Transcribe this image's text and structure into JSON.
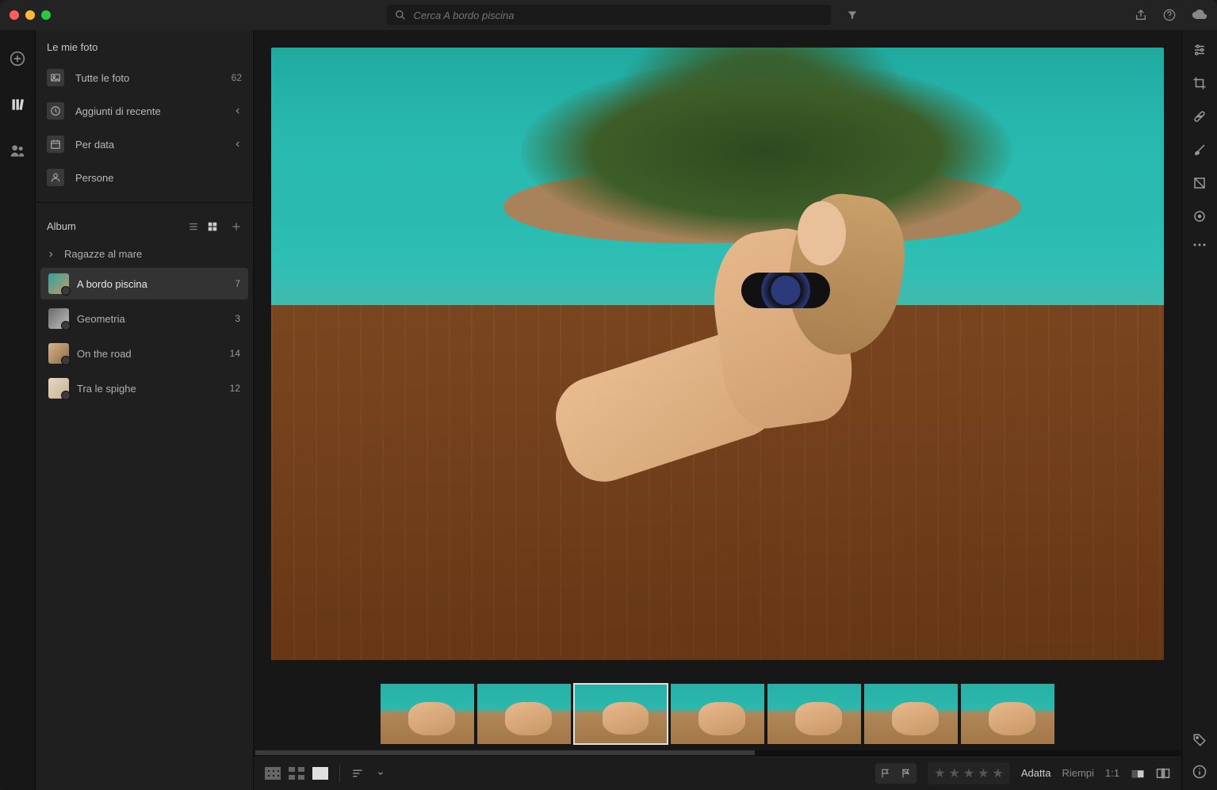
{
  "titlebar": {
    "search_placeholder": "Cerca A bordo piscina"
  },
  "sidebar": {
    "my_photos_header": "Le mie foto",
    "rows": [
      {
        "label": "Tutte le foto",
        "count": "62"
      },
      {
        "label": "Aggiunti di recente"
      },
      {
        "label": "Per data"
      },
      {
        "label": "Persone"
      }
    ],
    "album_header": "Album",
    "group_label": "Ragazze al mare",
    "albums": [
      {
        "label": "A bordo piscina",
        "count": "7",
        "selected": true,
        "thumb": "th-a"
      },
      {
        "label": "Geometria",
        "count": "3",
        "thumb": "th-b"
      },
      {
        "label": "On the road",
        "count": "14",
        "thumb": "th-c"
      },
      {
        "label": "Tra le spighe",
        "count": "12",
        "thumb": "th-d"
      }
    ]
  },
  "bottombar": {
    "fit": "Adatta",
    "fill": "Riempi",
    "one_to_one": "1:1"
  }
}
